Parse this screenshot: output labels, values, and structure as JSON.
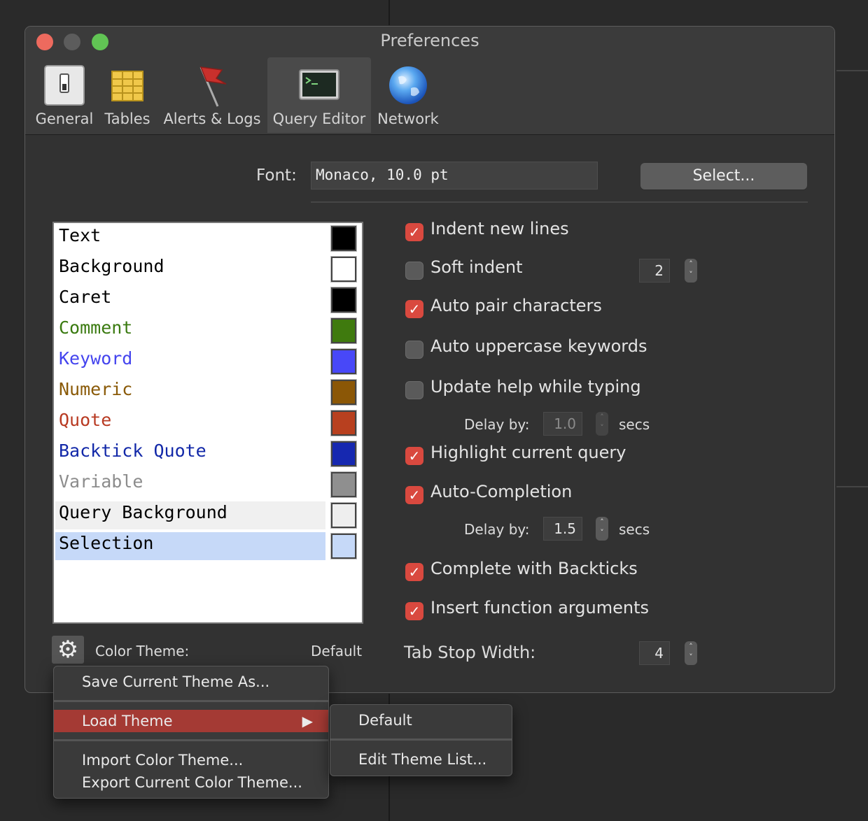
{
  "window": {
    "title": "Preferences",
    "traffic_lights": [
      "#ed6a5e",
      "#5c5c5c",
      "#61c454"
    ]
  },
  "toolbar": {
    "tabs": [
      {
        "label": "General",
        "icon": "switch-icon"
      },
      {
        "label": "Tables",
        "icon": "table-grid-icon"
      },
      {
        "label": "Alerts & Logs",
        "icon": "flag-icon"
      },
      {
        "label": "Query Editor",
        "icon": "terminal-icon",
        "active": true
      },
      {
        "label": "Network",
        "icon": "globe-icon"
      }
    ]
  },
  "font": {
    "label": "Font:",
    "value": "Monaco, 10.0 pt",
    "select_button": "Select..."
  },
  "color_list": {
    "items": [
      {
        "name": "Text",
        "text_color": "#000000",
        "swatch": "#000000"
      },
      {
        "name": "Background",
        "text_color": "#000000",
        "swatch": "#ffffff"
      },
      {
        "name": "Caret",
        "text_color": "#000000",
        "swatch": "#000000"
      },
      {
        "name": "Comment",
        "text_color": "#3a7a10",
        "swatch": "#3f7a0e"
      },
      {
        "name": "Keyword",
        "text_color": "#4444ee",
        "swatch": "#4848f8"
      },
      {
        "name": "Numeric",
        "text_color": "#8a5a08",
        "swatch": "#8b5706"
      },
      {
        "name": "Quote",
        "text_color": "#b83a22",
        "swatch": "#b8401f"
      },
      {
        "name": "Backtick Quote",
        "text_color": "#1228a8",
        "swatch": "#1628b0"
      },
      {
        "name": "Variable",
        "text_color": "#8c8c8c",
        "swatch": "#8f8f8f"
      },
      {
        "name": "Query Background",
        "text_color": "#000000",
        "swatch": "#eeeeee",
        "row_bg": "#f0f0f0"
      },
      {
        "name": "Selection",
        "text_color": "#000000",
        "swatch": "#c6d9f8",
        "row_bg": "#c6d9f8"
      }
    ]
  },
  "theme": {
    "label": "Color Theme:",
    "value": "Default"
  },
  "options": {
    "indent_new_lines": {
      "label": "Indent new lines",
      "checked": true
    },
    "soft_indent": {
      "label": "Soft indent",
      "checked": false,
      "value": "2"
    },
    "auto_pair": {
      "label": "Auto pair characters",
      "checked": true
    },
    "auto_uppercase": {
      "label": "Auto uppercase keywords",
      "checked": false
    },
    "update_help": {
      "label": "Update help while typing",
      "checked": false,
      "delay_label": "Delay by:",
      "delay_value": "1.0",
      "unit": "secs"
    },
    "highlight_query": {
      "label": "Highlight current query",
      "checked": true
    },
    "auto_completion": {
      "label": "Auto-Completion",
      "checked": true,
      "delay_label": "Delay by:",
      "delay_value": "1.5",
      "unit": "secs"
    },
    "complete_backticks": {
      "label": "Complete with Backticks",
      "checked": true
    },
    "insert_args": {
      "label": "Insert function arguments",
      "checked": true
    },
    "tab_stop": {
      "label": "Tab Stop Width:",
      "value": "4"
    }
  },
  "context_menu": {
    "save": "Save Current Theme As...",
    "load": "Load Theme",
    "import": "Import Color Theme...",
    "export": "Export Current Color Theme..."
  },
  "submenu": {
    "default": "Default",
    "edit": "Edit Theme List..."
  }
}
